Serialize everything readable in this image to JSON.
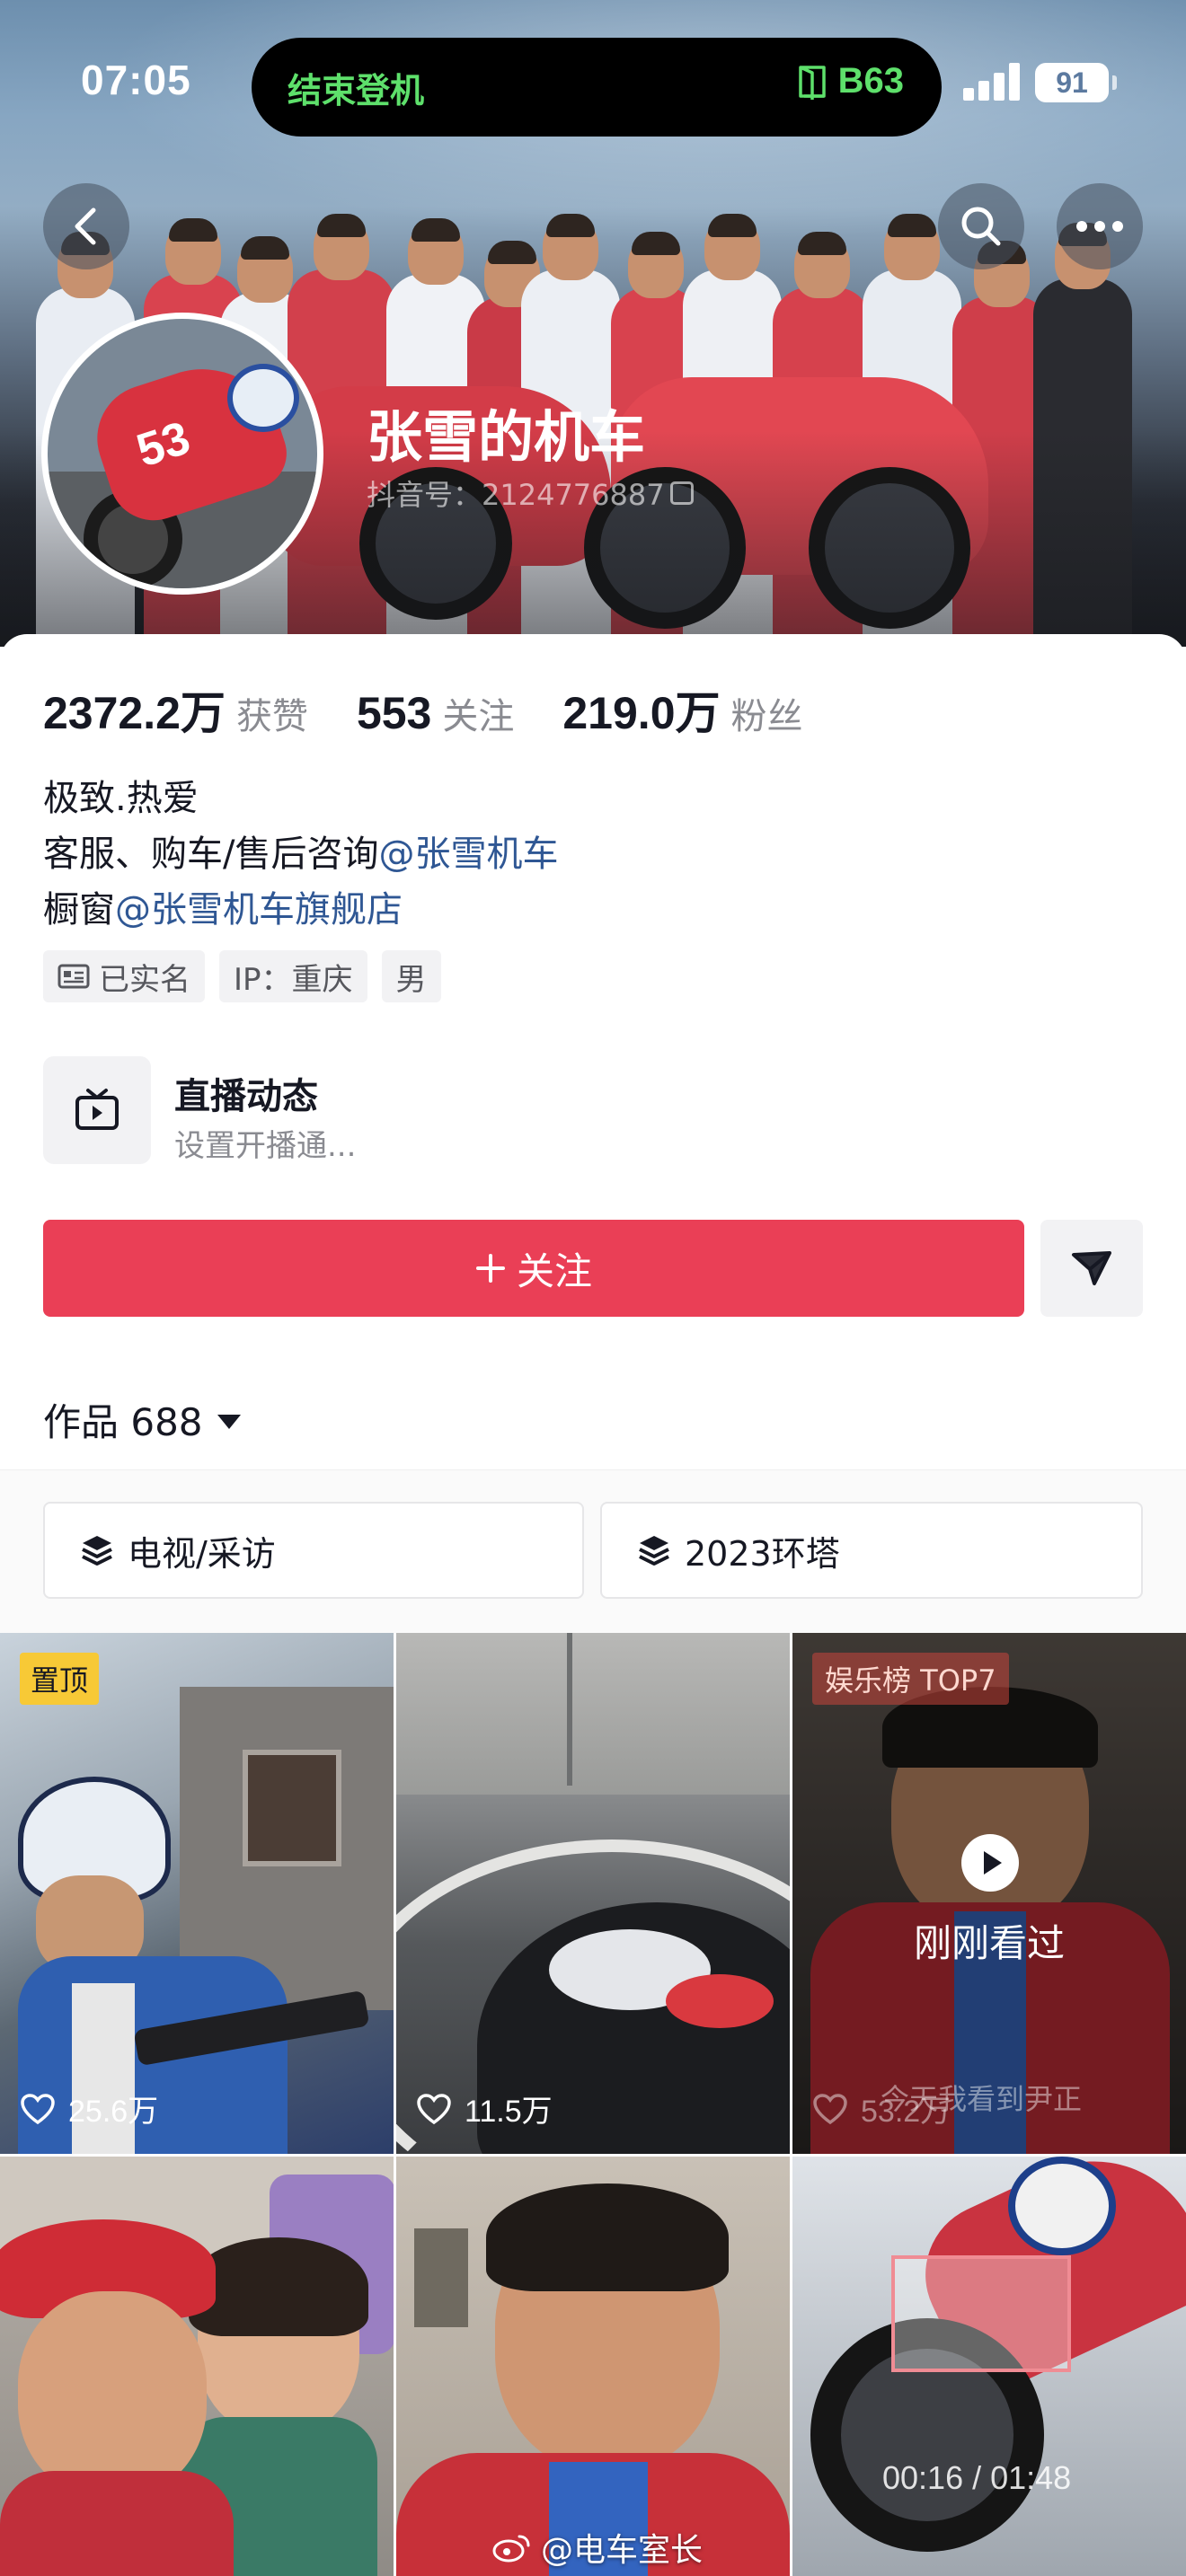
{
  "status_bar": {
    "time": "07:05",
    "activity_left": "结束登机",
    "activity_right": "B63",
    "battery": "91"
  },
  "profile": {
    "name": "张雪的机车",
    "douyin_id": "抖音号：2124776887",
    "stats": [
      {
        "value": "2372.2万",
        "label": "获赞"
      },
      {
        "value": "553",
        "label": "关注"
      },
      {
        "value": "219.0万",
        "label": "粉丝"
      }
    ],
    "bio": {
      "line1": "极致.热爱",
      "line2_prefix": "客服、购车/售后咨询",
      "line2_mention": "@张雪机车",
      "line3_prefix": "橱窗",
      "line3_mention": "@张雪机车旗舰店"
    },
    "tags": [
      "已实名",
      "IP：重庆",
      "男"
    ]
  },
  "live": {
    "title": "直播动态",
    "subtitle": "设置开播通..."
  },
  "actions": {
    "follow_label": "关注"
  },
  "works": {
    "label": "作品 688"
  },
  "collections": [
    "电视/采访",
    "2023环塔"
  ],
  "videos": [
    {
      "badge": "置顶",
      "likes": "25.6万"
    },
    {
      "likes": "11.5万"
    },
    {
      "badge": "娱乐榜 TOP7",
      "watched": "刚刚看过",
      "caption": "今天我看到尹正",
      "likes": "53.2万"
    },
    {},
    {},
    {
      "duration": "00:16 / 01:48"
    }
  ],
  "watermark": "@电车室长",
  "colors": {
    "accent": "#ea3f56",
    "mention": "#2f5794",
    "pin": "#f7c936",
    "island_text": "#5ee06b"
  }
}
